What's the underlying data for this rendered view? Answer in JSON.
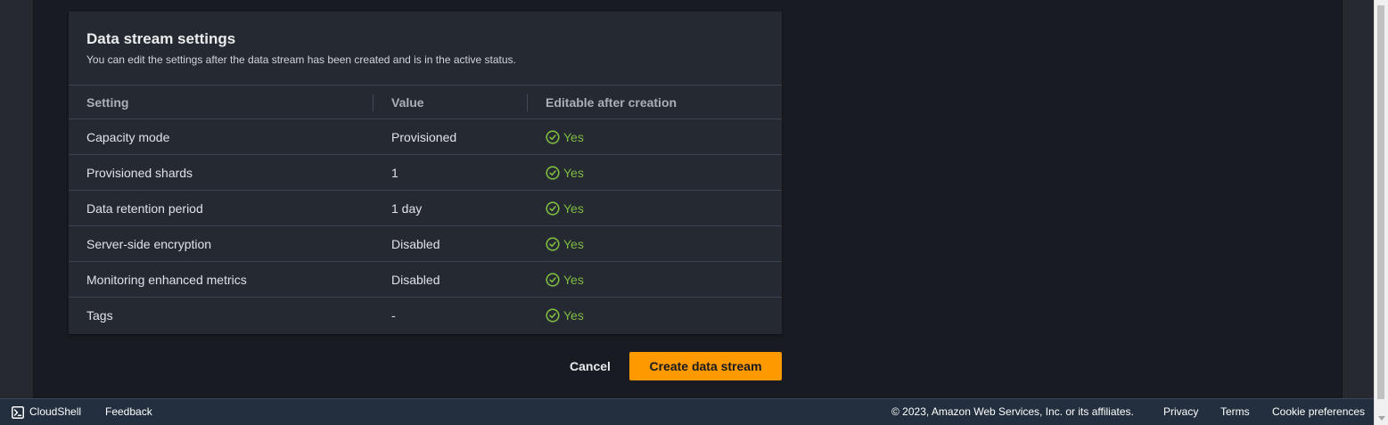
{
  "panel": {
    "title": "Data stream settings",
    "description": "You can edit the settings after the data stream has been created and is in the active status."
  },
  "table": {
    "columns": [
      "Setting",
      "Value",
      "Editable after creation"
    ],
    "rows": [
      {
        "setting": "Capacity mode",
        "value": "Provisioned",
        "editable": "Yes"
      },
      {
        "setting": "Provisioned shards",
        "value": "1",
        "editable": "Yes"
      },
      {
        "setting": "Data retention period",
        "value": "1 day",
        "editable": "Yes"
      },
      {
        "setting": "Server-side encryption",
        "value": "Disabled",
        "editable": "Yes"
      },
      {
        "setting": "Monitoring enhanced metrics",
        "value": "Disabled",
        "editable": "Yes"
      },
      {
        "setting": "Tags",
        "value": "-",
        "editable": "Yes"
      }
    ]
  },
  "actions": {
    "cancel_label": "Cancel",
    "create_label": "Create data stream"
  },
  "footer": {
    "cloudshell_label": "CloudShell",
    "feedback_label": "Feedback",
    "copyright": "© 2023, Amazon Web Services, Inc. or its affiliates.",
    "privacy_label": "Privacy",
    "terms_label": "Terms",
    "cookie_label": "Cookie preferences"
  },
  "colors": {
    "accent": "#ff9900",
    "success": "#7dbb42",
    "footer_bg": "#232f3e",
    "panel_bg": "#252931"
  },
  "icons": {
    "status": "check-circle-icon",
    "cloudshell": "terminal-icon"
  }
}
